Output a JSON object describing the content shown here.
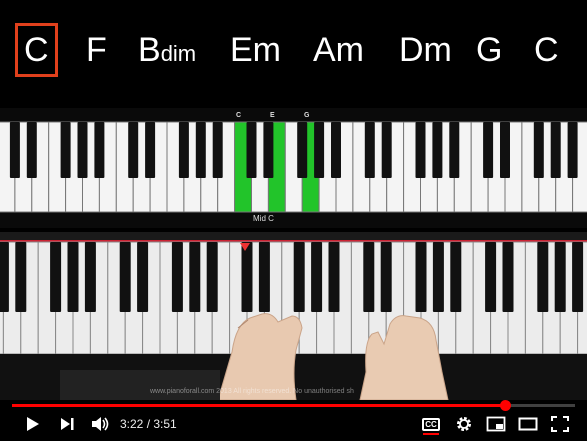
{
  "chords": [
    {
      "root": "C",
      "quality": "",
      "active": true
    },
    {
      "root": "F",
      "quality": "",
      "active": false
    },
    {
      "root": "B",
      "quality": "dim",
      "active": false
    },
    {
      "root": "Em",
      "quality": "",
      "active": false
    },
    {
      "root": "Am",
      "quality": "",
      "active": false
    },
    {
      "root": "Dm",
      "quality": "",
      "active": false
    },
    {
      "root": "G",
      "quality": "",
      "active": false
    },
    {
      "root": "C",
      "quality": "",
      "active": false
    }
  ],
  "diagram": {
    "note_labels": [
      "C",
      "E",
      "G"
    ],
    "mid_c_label": "Mid C",
    "highlight_color": "#22c42a"
  },
  "video": {
    "watermark": "www.pianoforall.com 2013  All rights reserved. No unauthorised sh"
  },
  "player": {
    "current_time": "3:22",
    "separator": " / ",
    "duration": "3:51",
    "progress": 0.875,
    "accent": "#ff0000",
    "cc_label": "CC",
    "icons": [
      "play-icon",
      "next-icon",
      "volume-icon",
      "captions-icon",
      "settings-icon",
      "miniplayer-icon",
      "theater-icon",
      "fullscreen-icon"
    ]
  }
}
